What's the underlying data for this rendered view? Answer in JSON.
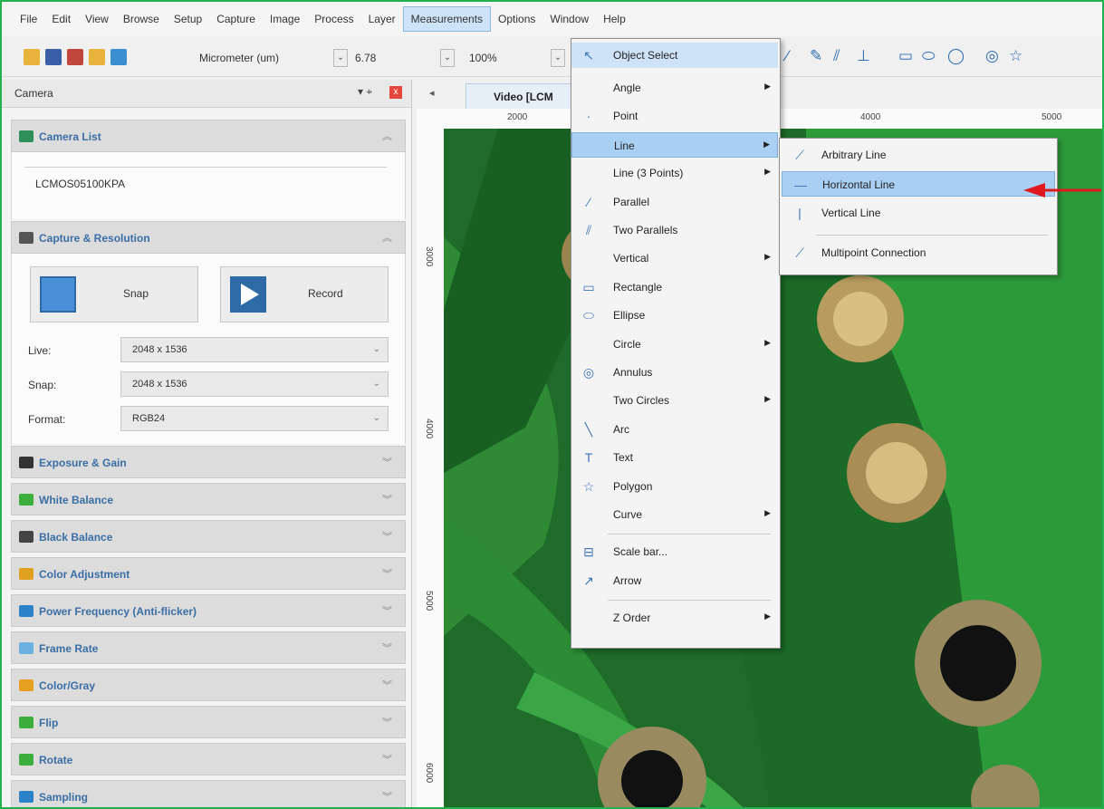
{
  "menubar": {
    "items": [
      "File",
      "Edit",
      "View",
      "Browse",
      "Setup",
      "Capture",
      "Image",
      "Process",
      "Layer",
      "Measurements",
      "Options",
      "Window",
      "Help"
    ],
    "active": "Measurements"
  },
  "toolbar": {
    "unit": "Micrometer (um)",
    "scale_value": "6.78",
    "zoom": "100%"
  },
  "camera_panel": {
    "title": "Camera",
    "pin_glyph": "▾ ⌖",
    "close_glyph": "x",
    "camera_list": {
      "header": "Camera List",
      "camera": "LCMOS05100KPA"
    },
    "capture": {
      "header": "Capture & Resolution",
      "snap_label": "Snap",
      "record_label": "Record",
      "live_label": "Live:",
      "live_value": "2048 x 1536",
      "snap_row_label": "Snap:",
      "snap_value": "2048 x 1536",
      "format_label": "Format:",
      "format_value": "RGB24"
    },
    "sections": [
      {
        "label": "Exposure & Gain",
        "icon": "exposure-icon",
        "color": "#333333"
      },
      {
        "label": "White Balance",
        "icon": "white-balance-icon",
        "color": "#3cae3c"
      },
      {
        "label": "Black Balance",
        "icon": "black-balance-icon",
        "color": "#444444"
      },
      {
        "label": "Color Adjustment",
        "icon": "color-wheel-icon",
        "color": "#e0a020"
      },
      {
        "label": "Power Frequency (Anti-flicker)",
        "icon": "power-frequency-icon",
        "color": "#2c82c9"
      },
      {
        "label": "Frame Rate",
        "icon": "frame-rate-icon",
        "color": "#6bb2e0"
      },
      {
        "label": "Color/Gray",
        "icon": "color-gray-icon",
        "color": "#e8a020"
      },
      {
        "label": "Flip",
        "icon": "flip-icon",
        "color": "#3cae3c"
      },
      {
        "label": "Rotate",
        "icon": "rotate-icon",
        "color": "#3cae3c"
      },
      {
        "label": "Sampling",
        "icon": "sampling-icon",
        "color": "#2c82c9"
      }
    ]
  },
  "image_view": {
    "tab_label": "Video [LCM",
    "h_ticks": [
      "2000",
      "4000",
      "5000"
    ],
    "v_ticks": [
      "3000",
      "4000",
      "5000",
      "6000"
    ]
  },
  "measurements_menu": {
    "items": [
      {
        "label": "Object Select",
        "icon": "cursor-select-icon",
        "glyph": "↖"
      },
      {
        "label": "Angle",
        "icon": "",
        "glyph": "",
        "submenu": true
      },
      {
        "label": "Point",
        "icon": "point-icon",
        "glyph": "·"
      },
      {
        "label": "Line",
        "icon": "",
        "glyph": "",
        "submenu": true,
        "highlighted": true
      },
      {
        "label": "Line (3 Points)",
        "icon": "",
        "glyph": "",
        "submenu": true
      },
      {
        "label": "Parallel",
        "icon": "parallel-icon",
        "glyph": "⁄"
      },
      {
        "label": "Two Parallels",
        "icon": "two-parallels-icon",
        "glyph": "⫽"
      },
      {
        "label": "Vertical",
        "icon": "",
        "glyph": "",
        "submenu": true
      },
      {
        "label": "Rectangle",
        "icon": "rectangle-icon",
        "glyph": "▭"
      },
      {
        "label": "Ellipse",
        "icon": "ellipse-icon",
        "glyph": "⬭"
      },
      {
        "label": "Circle",
        "icon": "",
        "glyph": "",
        "submenu": true
      },
      {
        "label": "Annulus",
        "icon": "annulus-icon",
        "glyph": "◎"
      },
      {
        "label": "Two Circles",
        "icon": "",
        "glyph": "",
        "submenu": true
      },
      {
        "label": "Arc",
        "icon": "arc-icon",
        "glyph": "╲"
      },
      {
        "label": "Text",
        "icon": "text-icon",
        "glyph": "T"
      },
      {
        "label": "Polygon",
        "icon": "polygon-icon",
        "glyph": "☆"
      },
      {
        "label": "Curve",
        "icon": "",
        "glyph": "",
        "submenu": true
      },
      {
        "label": "Scale bar...",
        "icon": "scale-bar-icon",
        "glyph": "⊟",
        "separator_before": true
      },
      {
        "label": "Arrow",
        "icon": "arrow-icon",
        "glyph": "↗"
      },
      {
        "label": "Z Order",
        "icon": "",
        "glyph": "",
        "submenu": true,
        "separator_before": true
      }
    ]
  },
  "line_submenu": {
    "items": [
      {
        "label": "Arbitrary Line",
        "icon": "arbitrary-line-icon",
        "glyph": "⟋"
      },
      {
        "label": "Horizontal Line",
        "icon": "horizontal-line-icon",
        "glyph": "—",
        "highlighted": true
      },
      {
        "label": "Vertical Line",
        "icon": "vertical-line-icon",
        "glyph": "|"
      },
      {
        "label": "Multipoint Connection",
        "icon": "multipoint-connection-icon",
        "glyph": "⟋",
        "separator_before": true
      }
    ]
  },
  "colors": {
    "frame_border": "#22b14c",
    "annotation_arrow": "#e0191e",
    "menu_highlight": "#a9cff3"
  }
}
